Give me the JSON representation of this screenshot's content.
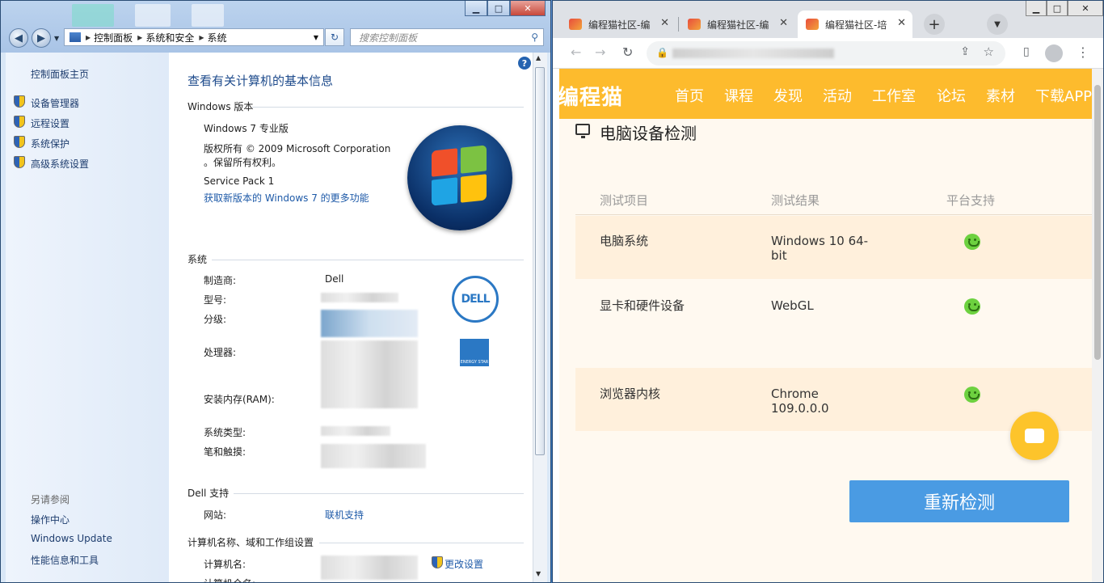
{
  "cp": {
    "window_buttons": {
      "min": "▁",
      "max": "□",
      "close": "✕"
    },
    "breadcrumb": [
      "控制面板",
      "系统和安全",
      "系统"
    ],
    "search_placeholder": "搜索控制面板",
    "left": {
      "home": "控制面板主页",
      "links": [
        "设备管理器",
        "远程设置",
        "系统保护",
        "高级系统设置"
      ],
      "see_also_title": "另请参阅",
      "see_also": [
        "操作中心",
        "Windows Update",
        "性能信息和工具"
      ]
    },
    "main": {
      "title": "查看有关计算机的基本信息",
      "edition_header": "Windows 版本",
      "edition": "Windows 7 专业版",
      "copyright_1": "版权所有 © 2009 Microsoft Corporation",
      "copyright_2": "。保留所有权利。",
      "service_pack": "Service Pack 1",
      "more_features": "获取新版本的 Windows 7 的更多功能",
      "system_header": "系统",
      "manufacturer_label": "制造商:",
      "manufacturer_value": "Dell",
      "model_label": "型号:",
      "rating_label": "分级:",
      "processor_label": "处理器:",
      "ram_label": "安装内存(RAM):",
      "systype_label": "系统类型:",
      "pen_label": "笔和触摸:",
      "support_header": "Dell 支持",
      "website_label": "网站:",
      "website_value": "联机支持",
      "computer_header": "计算机名称、域和工作组设置",
      "computer_name_label": "计算机名:",
      "full_name_label": "计算机全名:",
      "change_settings": "更改设置",
      "dell_logo": "DELL",
      "estar": "ENERGY STAR"
    }
  },
  "browser": {
    "tabs": [
      {
        "title": "编程猫社区-编"
      },
      {
        "title": "编程猫社区-编"
      },
      {
        "title": "编程猫社区-培"
      }
    ],
    "site": {
      "logo": "编程猫",
      "nav": [
        "首页",
        "课程",
        "发现",
        "活动",
        "工作室",
        "论坛",
        "素材",
        "下载APP"
      ],
      "section_title": "电脑设备检测",
      "columns": [
        "测试项目",
        "测试结果",
        "平台支持"
      ],
      "rows": [
        {
          "item": "电脑系统",
          "result_1": "Windows 10 64-",
          "result_2": "bit"
        },
        {
          "item": "显卡和硬件设备",
          "result_1": "WebGL",
          "result_2": ""
        },
        {
          "item": "浏览器内核",
          "result_1": "Chrome",
          "result_2": "109.0.0.0"
        }
      ],
      "recheck_button": "重新检测"
    }
  },
  "colors": {
    "accent": "#fdbb2d",
    "button": "#4a9be3",
    "support": "#6dd13f"
  }
}
